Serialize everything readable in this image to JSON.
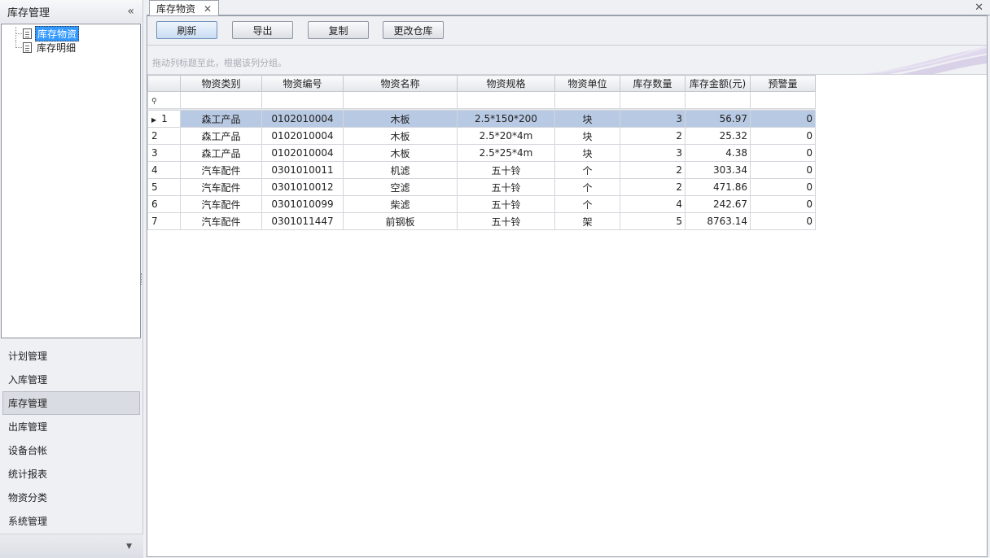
{
  "left_panel": {
    "title": "库存管理",
    "collapse_icon": "«",
    "tree": [
      {
        "label": "库存物资",
        "selected": true
      },
      {
        "label": "库存明细",
        "selected": false
      }
    ],
    "nav": [
      {
        "label": "计划管理",
        "active": false
      },
      {
        "label": "入库管理",
        "active": false
      },
      {
        "label": "库存管理",
        "active": true
      },
      {
        "label": "出库管理",
        "active": false
      },
      {
        "label": "设备台帐",
        "active": false
      },
      {
        "label": "统计报表",
        "active": false
      },
      {
        "label": "物资分类",
        "active": false
      },
      {
        "label": "系统管理",
        "active": false
      }
    ],
    "more_icon": "▼"
  },
  "tabs": [
    {
      "label": "库存物资",
      "close_icon": "✕"
    }
  ],
  "window_close_icon": "✕",
  "toolbar": {
    "refresh": "刷新",
    "export": "导出",
    "copy": "复制",
    "change_warehouse": "更改仓库"
  },
  "group_panel": {
    "hint": "拖动列标题至此，根据该列分组。"
  },
  "grid": {
    "columns": [
      "物资类别",
      "物资编号",
      "物资名称",
      "物资规格",
      "物资单位",
      "库存数量",
      "库存金额(元)",
      "预警量"
    ],
    "filter_icon": "⚲",
    "row_indicator_icon": "▶",
    "rows": [
      {
        "no": "1",
        "category": "森工产品",
        "code": "0102010004",
        "name": "木板",
        "spec": "2.5*150*200",
        "unit": "块",
        "qty": "3",
        "amount": "56.97",
        "warn": "0"
      },
      {
        "no": "2",
        "category": "森工产品",
        "code": "0102010004",
        "name": "木板",
        "spec": "2.5*20*4m",
        "unit": "块",
        "qty": "2",
        "amount": "25.32",
        "warn": "0"
      },
      {
        "no": "3",
        "category": "森工产品",
        "code": "0102010004",
        "name": "木板",
        "spec": "2.5*25*4m",
        "unit": "块",
        "qty": "3",
        "amount": "4.38",
        "warn": "0"
      },
      {
        "no": "4",
        "category": "汽车配件",
        "code": "0301010011",
        "name": "机滤",
        "spec": "五十铃",
        "unit": "个",
        "qty": "2",
        "amount": "303.34",
        "warn": "0"
      },
      {
        "no": "5",
        "category": "汽车配件",
        "code": "0301010012",
        "name": "空滤",
        "spec": "五十铃",
        "unit": "个",
        "qty": "2",
        "amount": "471.86",
        "warn": "0"
      },
      {
        "no": "6",
        "category": "汽车配件",
        "code": "0301010099",
        "name": "柴滤",
        "spec": "五十铃",
        "unit": "个",
        "qty": "4",
        "amount": "242.67",
        "warn": "0"
      },
      {
        "no": "7",
        "category": "汽车配件",
        "code": "0301011447",
        "name": "前钢板",
        "spec": "五十铃",
        "unit": "架",
        "qty": "5",
        "amount": "8763.14",
        "warn": "0"
      }
    ],
    "selected_row": 0
  }
}
